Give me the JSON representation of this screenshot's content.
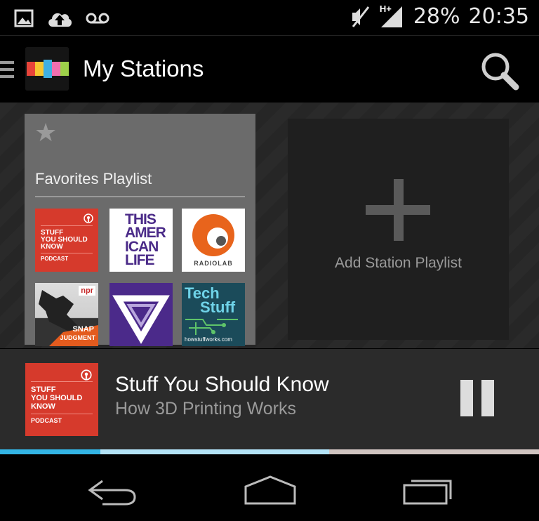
{
  "status_bar": {
    "icons": [
      "gallery-icon",
      "cloud-upload-icon",
      "voicemail-icon",
      "mute-icon",
      "signal-icon"
    ],
    "network": "H+",
    "battery": "28%",
    "time": "20:35"
  },
  "action_bar": {
    "title": "My Stations",
    "logo_colors": [
      "#e8443a",
      "#f6c631",
      "#3fb0e2",
      "#f06fb0",
      "#9ed14a"
    ]
  },
  "favorites": {
    "title": "Favorites Playlist",
    "podcasts": [
      {
        "name": "Stuff You Should Know",
        "art_lines": [
          "STUFF",
          "YOU SHOULD",
          "KNOW"
        ],
        "badge": "PODCAST"
      },
      {
        "name": "This American Life",
        "art_lines": [
          "THIS",
          "AMER",
          "ICAN",
          "LIFE"
        ]
      },
      {
        "name": "Radiolab",
        "art_lines": [
          "RADIOLAB"
        ]
      },
      {
        "name": "Snap Judgment",
        "art_lines": [
          "npr",
          "SNAP",
          "JUDGMENT"
        ]
      },
      {
        "name": "Penrose triangle podcast",
        "art_lines": []
      },
      {
        "name": "TechStuff",
        "art_lines": [
          "Tech",
          "Stuff",
          "howstuffworks.com"
        ]
      }
    ]
  },
  "add_station": {
    "label": "Add Station Playlist"
  },
  "now_playing": {
    "title": "Stuff You Should Know",
    "episode": "How 3D Printing Works",
    "art_lines": [
      "STUFF",
      "YOU SHOULD",
      "KNOW"
    ],
    "badge": "PODCAST",
    "progress_fraction": 0.186,
    "buffered_fraction": 0.611
  },
  "colors": {
    "accent": "#33b5e5",
    "sysk_red": "#d63a2c",
    "tal_purple": "#4a2a88",
    "radiolab_orange": "#e8641c",
    "techstuff_teal": "#1b4b5a"
  }
}
